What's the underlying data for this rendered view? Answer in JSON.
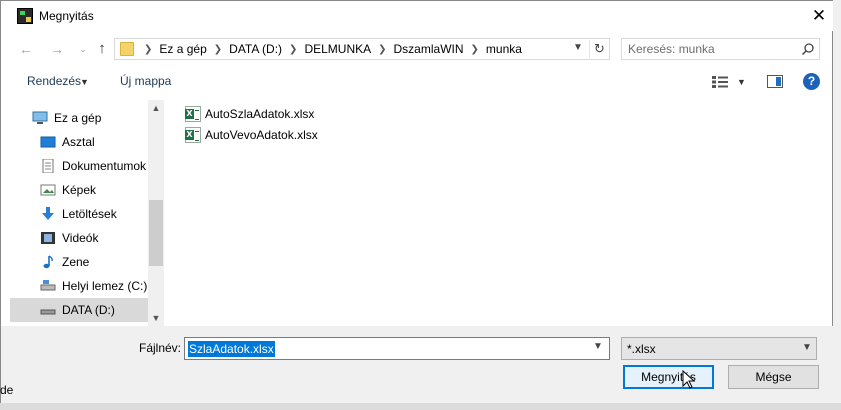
{
  "window": {
    "title": "Megnyitás"
  },
  "background": {
    "left_fragment": "de"
  },
  "address": {
    "crumbs": [
      "Ez a gép",
      "DATA (D:)",
      "DELMUNKA",
      "DszamlaWIN",
      "munka"
    ]
  },
  "search": {
    "placeholder": "Keresés: munka"
  },
  "toolbar": {
    "organize": "Rendezés",
    "new_folder": "Új mappa"
  },
  "nav": {
    "items": [
      {
        "label": "Ez a gép",
        "icon": "computer-icon"
      },
      {
        "label": "Asztal",
        "icon": "desktop-icon"
      },
      {
        "label": "Dokumentumok",
        "icon": "documents-icon"
      },
      {
        "label": "Képek",
        "icon": "pictures-icon"
      },
      {
        "label": "Letöltések",
        "icon": "downloads-icon"
      },
      {
        "label": "Videók",
        "icon": "videos-icon"
      },
      {
        "label": "Zene",
        "icon": "music-icon"
      },
      {
        "label": "Helyi lemez (C:)",
        "icon": "drive-icon"
      },
      {
        "label": "DATA (D:)",
        "icon": "drive-icon",
        "selected": true
      }
    ]
  },
  "files": [
    {
      "name": "AutoSzlaAdatok.xlsx",
      "icon": "excel-file-icon"
    },
    {
      "name": "AutoVevoAdatok.xlsx",
      "icon": "excel-file-icon"
    }
  ],
  "filename": {
    "label": "Fájlnév:",
    "value": "SzlaAdatok.xlsx"
  },
  "filter": {
    "value": "*.xlsx"
  },
  "buttons": {
    "open": "Megnyitás",
    "cancel": "Mégse"
  },
  "colors": {
    "selection": "#0078d7",
    "accent_button_border": "#0078d7",
    "toolbar_text": "#1e3957"
  }
}
